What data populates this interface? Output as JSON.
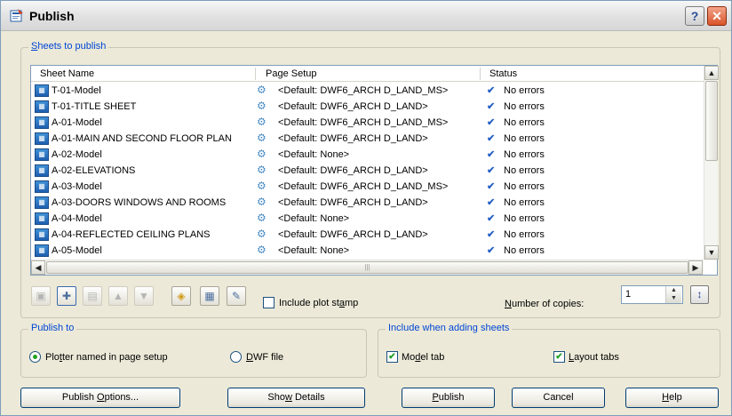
{
  "window": {
    "title": "Publish",
    "help_label": "?",
    "close_label": "✕"
  },
  "sheets_group": {
    "label_hotkey": "S",
    "label_rest": "heets to publish",
    "columns": [
      "Sheet Name",
      "Page Setup",
      "Status"
    ],
    "rows": [
      {
        "name": "T-01-Model",
        "setup": "<Default: DWF6_ARCH D_LAND_MS>",
        "status": "No errors"
      },
      {
        "name": "T-01-TITLE SHEET",
        "setup": "<Default: DWF6_ARCH D_LAND>",
        "status": "No errors"
      },
      {
        "name": "A-01-Model",
        "setup": "<Default: DWF6_ARCH D_LAND_MS>",
        "status": "No errors"
      },
      {
        "name": "A-01-MAIN AND SECOND FLOOR PLAN",
        "setup": "<Default: DWF6_ARCH D_LAND>",
        "status": "No errors"
      },
      {
        "name": "A-02-Model",
        "setup": "<Default: None>",
        "status": "No errors"
      },
      {
        "name": "A-02-ELEVATIONS",
        "setup": "<Default: DWF6_ARCH D_LAND>",
        "status": "No errors"
      },
      {
        "name": "A-03-Model",
        "setup": "<Default: DWF6_ARCH D_LAND_MS>",
        "status": "No errors"
      },
      {
        "name": "A-03-DOORS WINDOWS AND ROOMS",
        "setup": "<Default: DWF6_ARCH D_LAND>",
        "status": "No errors"
      },
      {
        "name": "A-04-Model",
        "setup": "<Default: None>",
        "status": "No errors"
      },
      {
        "name": "A-04-REFLECTED CEILING PLANS",
        "setup": "<Default: DWF6_ARCH D_LAND>",
        "status": "No errors"
      },
      {
        "name": "A-05-Model",
        "setup": "<Default: None>",
        "status": "No errors"
      }
    ],
    "include_plot_stamp_pre": "Include plot st",
    "include_plot_stamp_hotkey": "a",
    "include_plot_stamp_post": "mp",
    "include_plot_stamp_checked": false,
    "copies_label_hotkey": "N",
    "copies_label_rest": "umber of copies:",
    "copies_value": "1"
  },
  "publish_to": {
    "label": "Publish to",
    "plotter_pre": "Plo",
    "plotter_hotkey": "t",
    "plotter_post": "ter named in page setup",
    "dwf_hotkey": "D",
    "dwf_rest": "WF file",
    "selected": "plotter"
  },
  "include_when_adding": {
    "label": "Include when adding sheets",
    "model_tab_pre": "Mo",
    "model_tab_hotkey": "d",
    "model_tab_post": "el tab",
    "model_tab_checked": true,
    "layout_tabs_hotkey": "L",
    "layout_tabs_rest": "ayout tabs",
    "layout_tabs_checked": true
  },
  "buttons": {
    "publish_options_pre": "Publish ",
    "publish_options_hotkey": "O",
    "publish_options_post": "ptions...",
    "show_details_pre": "Sho",
    "show_details_hotkey": "w",
    "show_details_post": " Details",
    "publish_hotkey": "P",
    "publish_rest": "ublish",
    "cancel": "Cancel",
    "help_hotkey": "H",
    "help_rest": "elp"
  },
  "icons": {
    "check": "✔",
    "sheet": "sheet-layout-icon",
    "page_setup": "page-setup-icon"
  }
}
